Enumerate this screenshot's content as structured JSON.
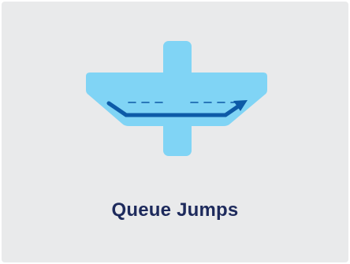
{
  "card": {
    "title": "Queue Jumps"
  },
  "illustration": {
    "icon": "queue-jump-intersection-icon"
  },
  "colors": {
    "background": "#e9eaeb",
    "road": "#80d4f5",
    "path": "#0d5aa7",
    "title": "#1d2a5c"
  }
}
